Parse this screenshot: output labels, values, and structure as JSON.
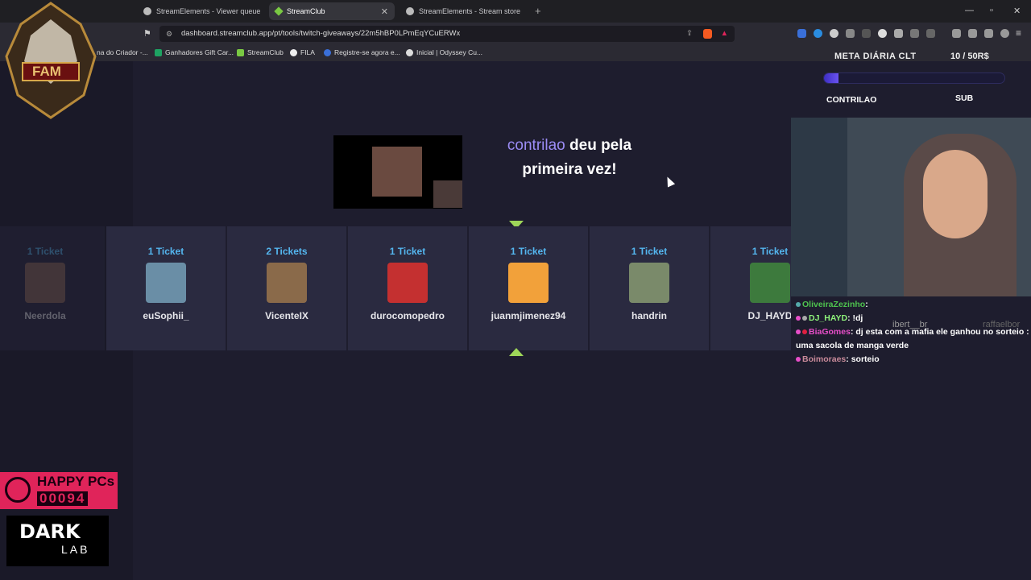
{
  "browser": {
    "tabs": [
      {
        "label": "StreamElements - Viewer queue"
      },
      {
        "label": "StreamClub"
      },
      {
        "label": "StreamElements - Stream store"
      }
    ],
    "url": "dashboard.streamclub.app/pt/tools/twitch-giveaways/22m5hBP0LPmEqYCuERWx",
    "bookmarks": [
      {
        "label": "na do Criador -..."
      },
      {
        "label": "Ganhadores Gift Car..."
      },
      {
        "label": "StreamClub"
      },
      {
        "label": "FILA"
      },
      {
        "label": "Registre-se agora e..."
      },
      {
        "label": "Inicial | Odyssey Cu..."
      }
    ]
  },
  "giveaway": {
    "winner_name": "contrilao",
    "winner_msg_1": "deu pela",
    "winner_msg_2": "primeira vez!",
    "entries": [
      {
        "tickets": "1 Ticket",
        "user": "Neerdola",
        "color": "#8c6b5a"
      },
      {
        "tickets": "1 Ticket",
        "user": "euSophii_",
        "color": "#6a8ea6"
      },
      {
        "tickets": "2 Tickets",
        "user": "VicenteIX",
        "color": "#8a6a4a"
      },
      {
        "tickets": "1 Ticket",
        "user": "durocomopedro",
        "color": "#c43030"
      },
      {
        "tickets": "1 Ticket",
        "user": "juanmjimenez94",
        "color": "#f2a13a"
      },
      {
        "tickets": "1 Ticket",
        "user": "handrin",
        "color": "#7a8a6a"
      },
      {
        "tickets": "1 Ticket",
        "user": "DJ_HAYD",
        "color": "#3d7a3d"
      }
    ]
  },
  "overlay": {
    "meta_title": "META DIÁRIA CLT",
    "meta_value": "10 / 50R$",
    "meta_progress": 0.08,
    "meta_left": "CONTRILAO",
    "meta_right": "SUB",
    "chat": [
      {
        "user": "OliveiraZezinho",
        "text": ""
      },
      {
        "user": "DJ_HAYD",
        "text": "!dj"
      },
      {
        "user": "BiaGomes",
        "text": "dj esta com a mafia ele ganhou no sorteio : uma sacola de manga verde"
      },
      {
        "user": "Boimoraes",
        "text": "sorteio"
      }
    ],
    "chat_ghost_1": "ibert__br",
    "chat_ghost_2": "raffaelbor"
  },
  "brand": {
    "fam": "FAM",
    "happy": "HAPPY PCs",
    "happy_num": "00094",
    "dark": "DARK",
    "lab": "LAB"
  }
}
